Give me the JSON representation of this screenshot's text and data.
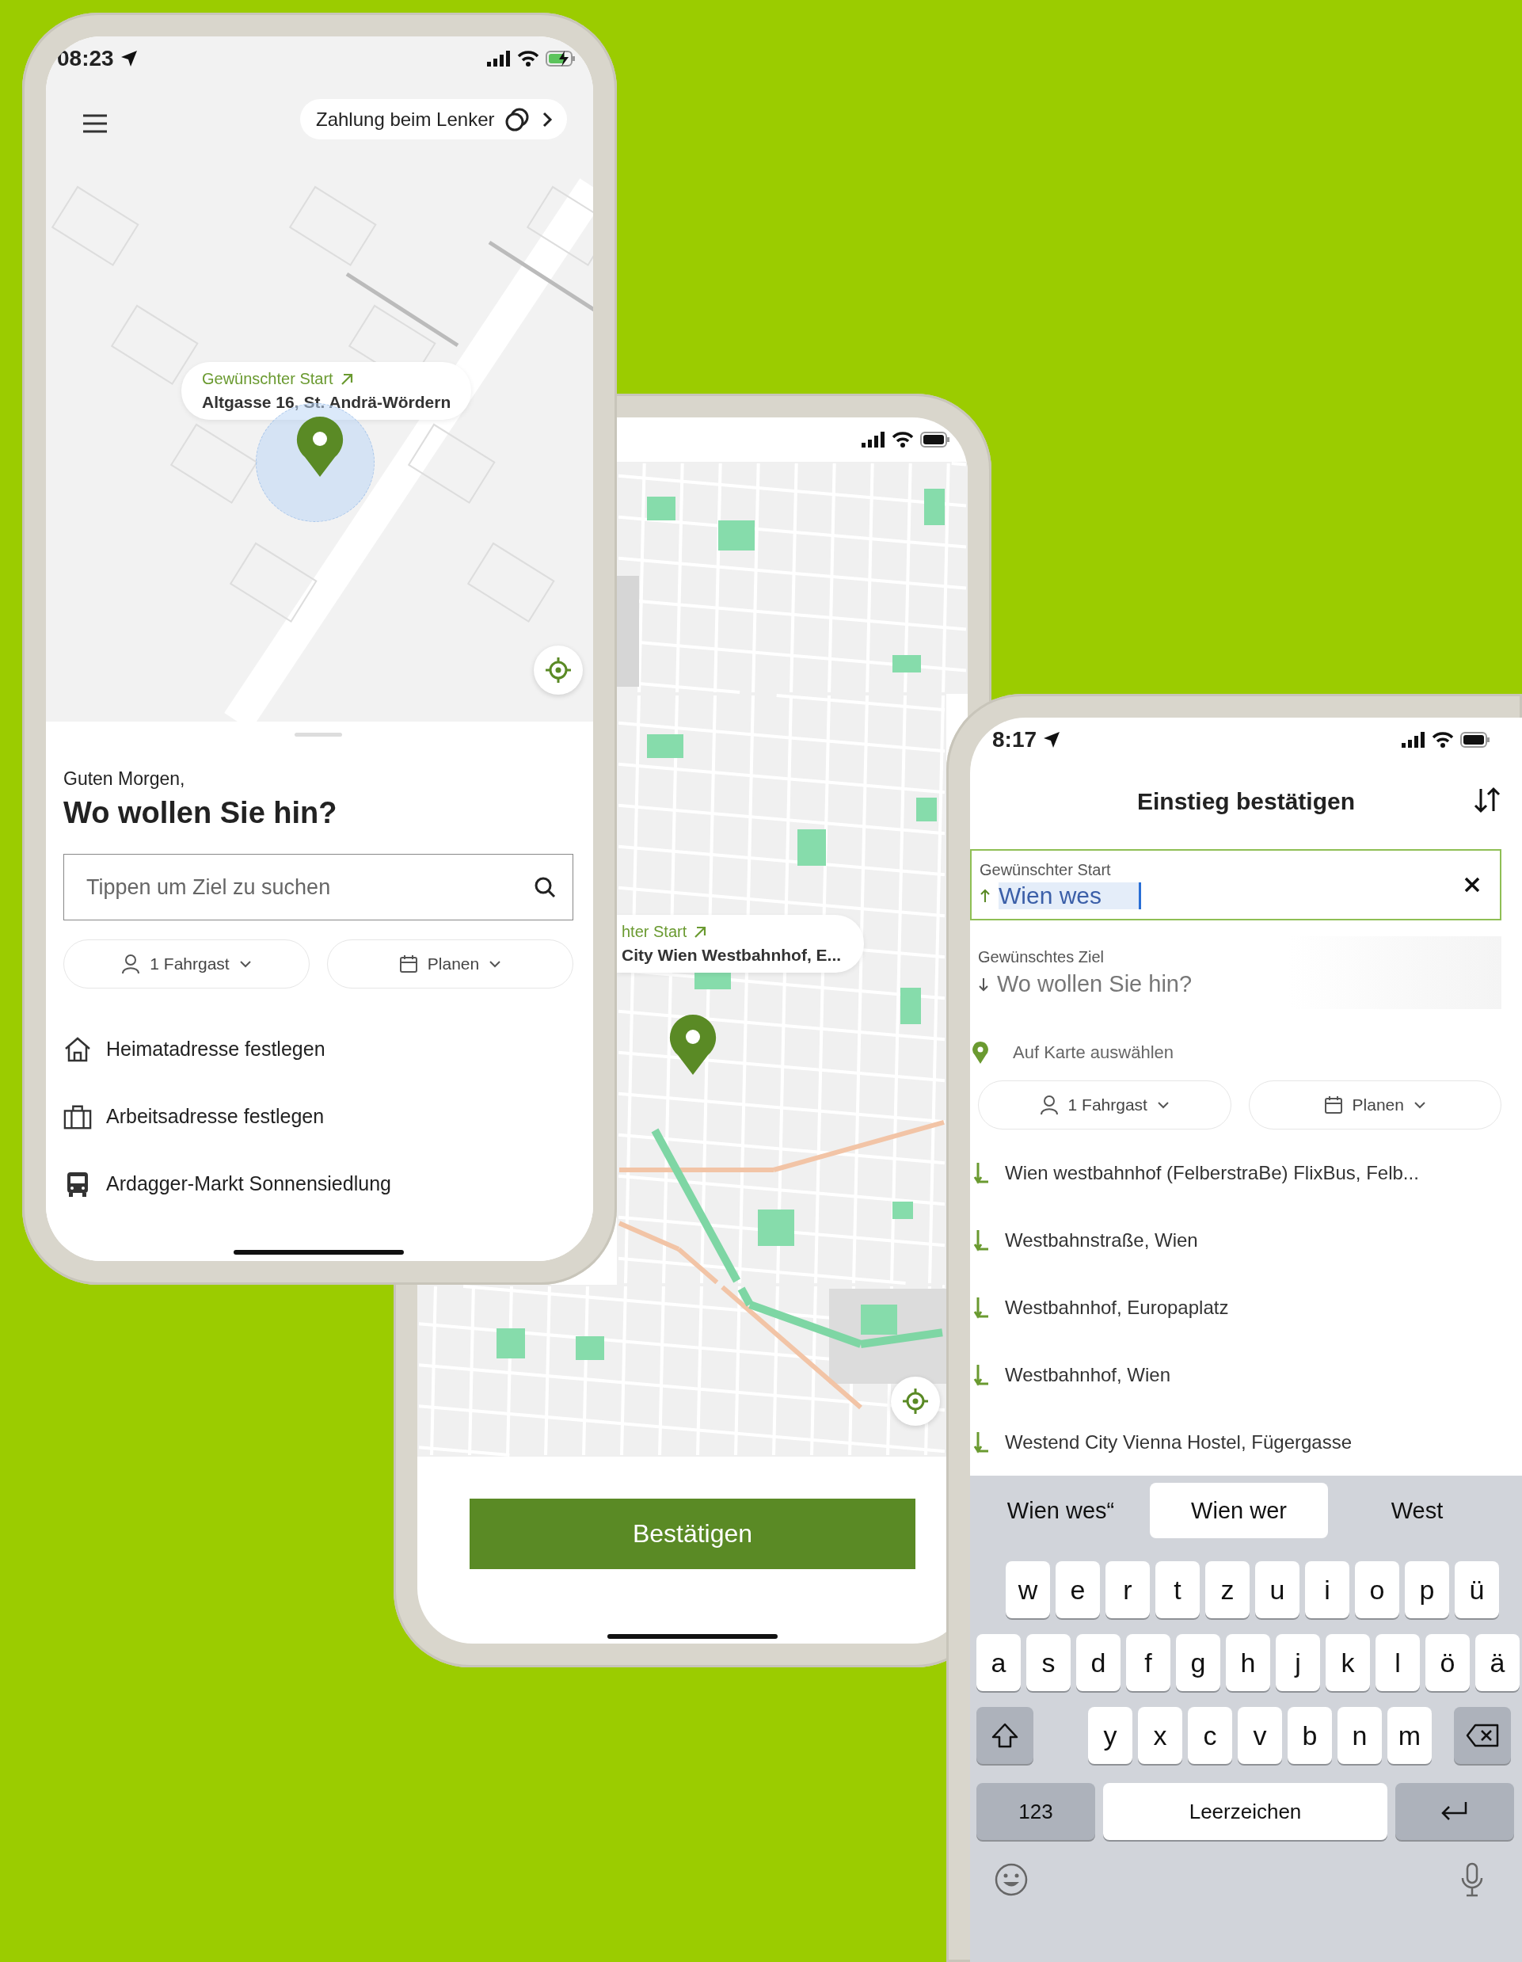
{
  "home_screen": {
    "status_bar": {
      "time": "08:23",
      "charging": true
    },
    "payment_button": "Zahlung beim Lenker",
    "pickup_callout": {
      "label": "Gewünschter Start",
      "address": "Altgasse 16, St. Andrä-Wördern"
    },
    "greeting": "Guten Morgen,",
    "heading": "Wo wollen Sie hin?",
    "search": {
      "placeholder": "Tippen um Ziel zu suchen"
    },
    "passengers": "1 Fahrgast",
    "plan": "Planen",
    "shortcuts": [
      {
        "kind": "home",
        "label": "Heimatadresse festlegen"
      },
      {
        "kind": "work",
        "label": "Arbeitsadresse festlegen"
      },
      {
        "kind": "bus",
        "label": "Ardagger-Markt Sonnensiedlung"
      }
    ]
  },
  "confirm_screen": {
    "status_bar": {
      "charging": false
    },
    "pickup_callout": {
      "label": "hter Start",
      "address": "City Wien Westbahnhof, E..."
    },
    "confirm_button": "Bestätigen"
  },
  "search_screen": {
    "status_bar": {
      "time": "8:17",
      "charging": false
    },
    "title": "Einstieg bestätigen",
    "start_field": {
      "label": "Gewünschter Start",
      "value": "Wien wes"
    },
    "destination_field": {
      "label": "Gewünschtes Ziel",
      "placeholder": "Wo wollen Sie hin?"
    },
    "map_pick": "Auf Karte auswählen",
    "passengers": "1 Fahrgast",
    "plan": "Planen",
    "suggestions": [
      "Wien westbahnhof (FelberstraBe) FlixBus, Felb...",
      "Westbahnstraße, Wien",
      "Westbahnhof, Europaplatz",
      "Westbahnhof, Wien",
      "Westend City Vienna Hostel, Fügergasse"
    ],
    "keyboard": {
      "predictions": [
        {
          "text": "Wien wes“",
          "selected": false
        },
        {
          "text": "Wien wer",
          "selected": true
        },
        {
          "text": "West",
          "selected": false
        }
      ],
      "rows": [
        [
          "w",
          "e",
          "r",
          "t",
          "z",
          "u",
          "i",
          "o",
          "p",
          "ü"
        ],
        [
          "a",
          "s",
          "d",
          "f",
          "g",
          "h",
          "j",
          "k",
          "l",
          "ö",
          "ä"
        ],
        [
          "y",
          "x",
          "c",
          "v",
          "b",
          "n",
          "m"
        ]
      ],
      "number_key": "123",
      "space_key": "Leerzeichen"
    }
  }
}
